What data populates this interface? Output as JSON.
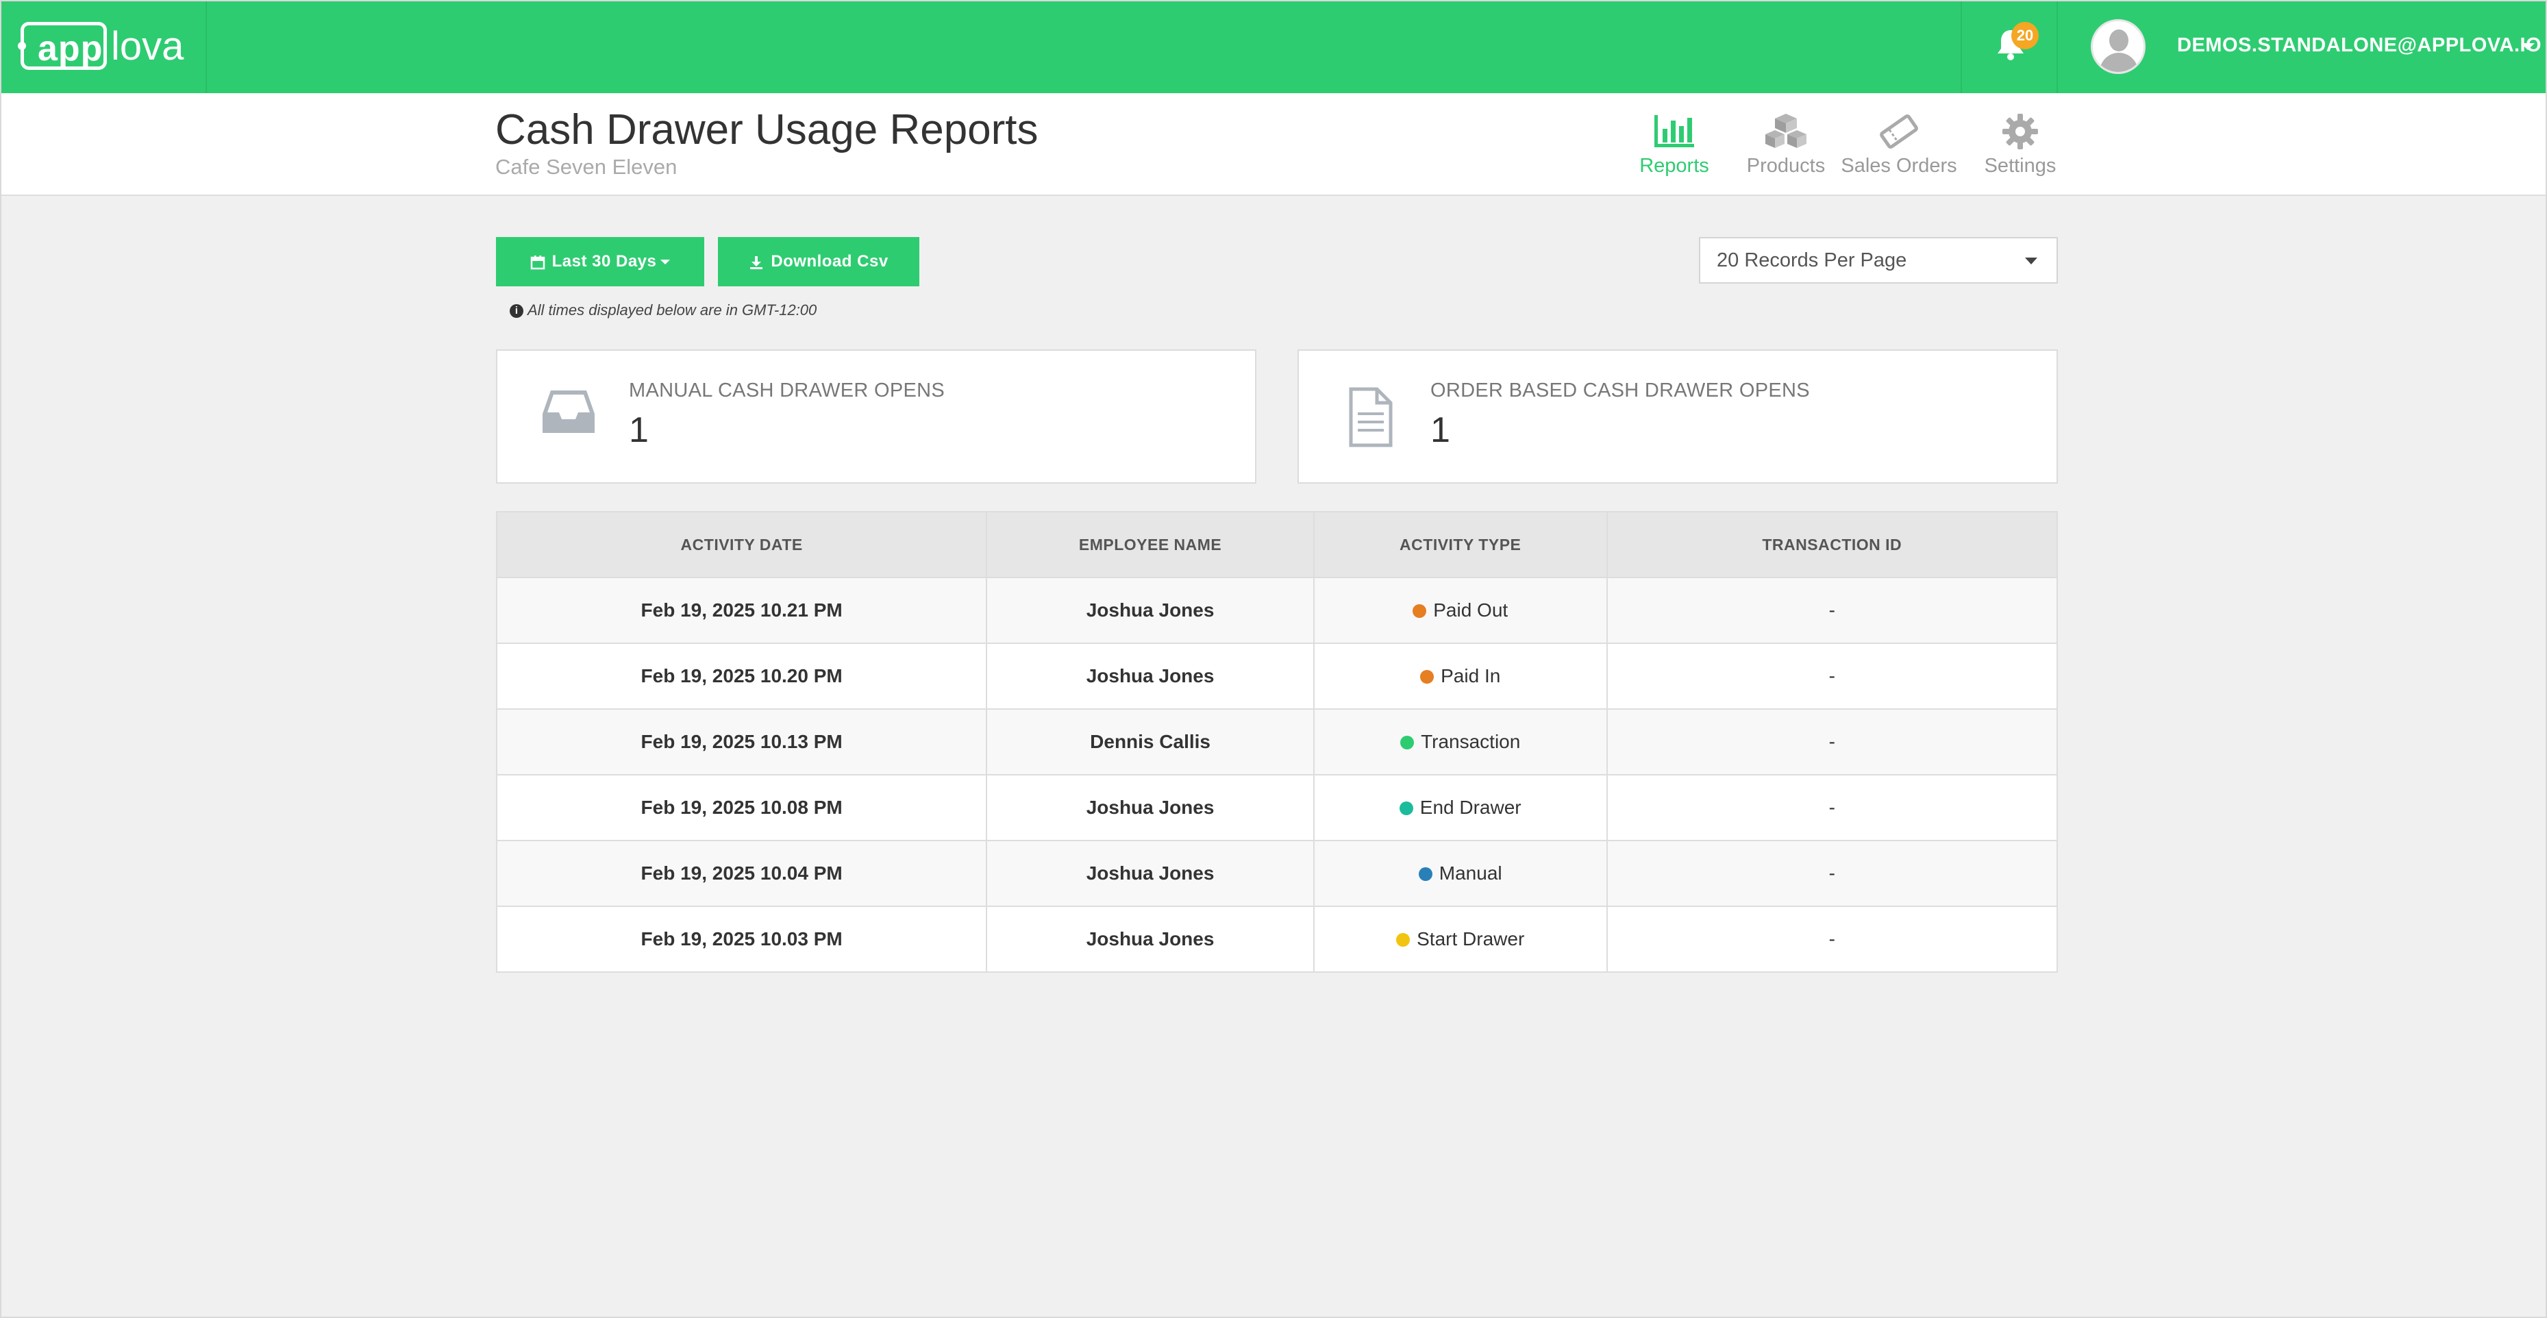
{
  "brand": {
    "logo_app": "app",
    "logo_lova": "lova"
  },
  "topbar": {
    "notifications_count": "20",
    "user_email": "DEMOS.STANDALONE@APPLOVA.IO"
  },
  "header": {
    "title": "Cash Drawer Usage Reports",
    "subtitle": "Cafe Seven Eleven"
  },
  "nav": [
    {
      "label": "Reports",
      "icon": "bar-chart-icon",
      "active": true
    },
    {
      "label": "Products",
      "icon": "cubes-icon",
      "active": false
    },
    {
      "label": "Sales Orders",
      "icon": "ticket-icon",
      "active": false
    },
    {
      "label": "Settings",
      "icon": "gear-icon",
      "active": false
    }
  ],
  "toolbar": {
    "date_range_label": "Last 30 Days",
    "download_label": "Download Csv",
    "timezone_note": "All times displayed below are in GMT-12:00",
    "per_page_value": "20 Records Per Page"
  },
  "stats": {
    "manual": {
      "label": "MANUAL CASH DRAWER OPENS",
      "value": "1"
    },
    "order": {
      "label": "ORDER BASED CASH DRAWER OPENS",
      "value": "1"
    }
  },
  "table": {
    "headers": [
      "ACTIVITY DATE",
      "EMPLOYEE NAME",
      "ACTIVITY TYPE",
      "TRANSACTION ID"
    ],
    "rows": [
      {
        "date": "Feb 19, 2025 10.21 PM",
        "employee": "Joshua Jones",
        "type": "Paid Out",
        "type_color": "#e67e22",
        "transaction_id": "-"
      },
      {
        "date": "Feb 19, 2025 10.20 PM",
        "employee": "Joshua Jones",
        "type": "Paid In",
        "type_color": "#e67e22",
        "transaction_id": "-"
      },
      {
        "date": "Feb 19, 2025 10.13 PM",
        "employee": "Dennis Callis",
        "type": "Transaction",
        "type_color": "#2ecc71",
        "transaction_id": "-"
      },
      {
        "date": "Feb 19, 2025 10.08 PM",
        "employee": "Joshua Jones",
        "type": "End Drawer",
        "type_color": "#1abc9c",
        "transaction_id": "-"
      },
      {
        "date": "Feb 19, 2025 10.04 PM",
        "employee": "Joshua Jones",
        "type": "Manual",
        "type_color": "#2980b9",
        "transaction_id": "-"
      },
      {
        "date": "Feb 19, 2025 10.03 PM",
        "employee": "Joshua Jones",
        "type": "Start Drawer",
        "type_color": "#f1c40f",
        "transaction_id": "-"
      }
    ]
  },
  "colors": {
    "brand_green": "#2ecc71",
    "badge_orange": "#f5a623"
  }
}
